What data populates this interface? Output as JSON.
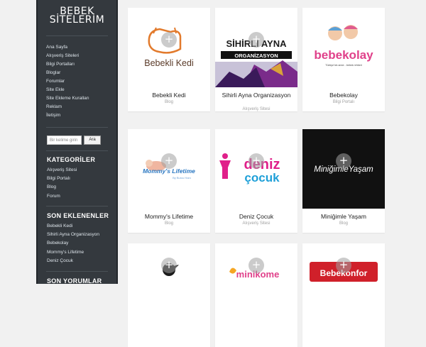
{
  "site": {
    "title_line1": "BEBEK",
    "title_line2": "SİTELERİM"
  },
  "nav": [
    "Ana Sayfa",
    "Alışveriş Siteleri",
    "Bilgi Portalları",
    "Bloglar",
    "Forumlar",
    "Site Ekle",
    "Site Ekleme Kuralları",
    "Reklam",
    "İletişim"
  ],
  "search": {
    "placeholder": "Bir kelime girin",
    "button": "Ara"
  },
  "categories": {
    "title": "KATEGORİLER",
    "items": [
      "Alışveriş Sitesi",
      "Bilgi Portalı",
      "Blog",
      "Forum"
    ]
  },
  "recent": {
    "title": "SON EKLENENLER",
    "items": [
      "Bebekli Kedi",
      "Sihirli Ayna Organizasyon",
      "Bebekolay",
      "Mommy's Lifetime",
      "Deniz Çocuk"
    ]
  },
  "comments": {
    "title": "SON YORUMLAR"
  },
  "cards": [
    {
      "name": "Bebekli Kedi",
      "category": "Blog",
      "logo_text": "Bebekli Kedi"
    },
    {
      "name": "Sihirli Ayna Organizasyon",
      "category": "Alışveriş Sitesi",
      "logo_text": "SİHİRLİ AYNA",
      "logo_sub": "ORGANİZASYON"
    },
    {
      "name": "Bebekolay",
      "category": "Bilgi Portalı",
      "logo_text": "bebekolay",
      "logo_sub": "Türkiye'nin anne - bebek rehberi"
    },
    {
      "name": "Mommy's Lifetime",
      "category": "Blog",
      "logo_text": "Mommy's Lifetime",
      "logo_sub": "By Burcu Hanı"
    },
    {
      "name": "Deniz Çocuk",
      "category": "Alışveriş Sitesi",
      "logo_text": "deniz",
      "logo_sub": "çocuk"
    },
    {
      "name": "Miniğimle Yaşam",
      "category": "Blog",
      "logo_text": "MiniğimleYaşam"
    },
    {
      "name": "",
      "category": ""
    },
    {
      "name": "",
      "category": "",
      "logo_text": "minikome"
    },
    {
      "name": "",
      "category": "",
      "logo_text": "Bebekonfor"
    }
  ],
  "plus_symbol": "+",
  "colors": {
    "sidebar": "#34393e",
    "page": "#f1f1f1",
    "card": "#ffffff",
    "muted": "#a0a0a0"
  }
}
